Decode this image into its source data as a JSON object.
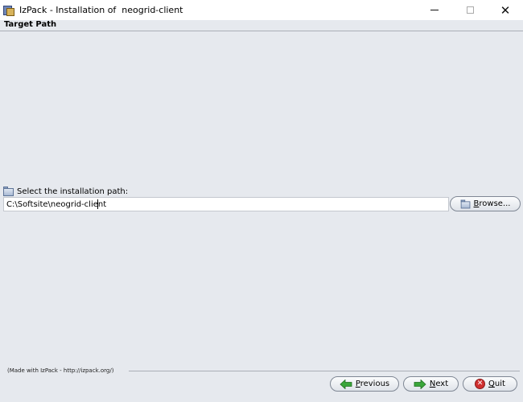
{
  "window": {
    "title": "IzPack - Installation of  neogrid-client",
    "icon": "izpack-app-icon",
    "controls": {
      "minimize": "minimize-icon",
      "maximize": "maximize-icon",
      "close": "✕"
    }
  },
  "panel": {
    "header": "Target Path",
    "path_label": "Select the installation path:",
    "path_value": "C:\\Softsite\\neogrid-client",
    "browse": {
      "mnemonic": "B",
      "rest": "rowse..."
    }
  },
  "footer": {
    "made_with": "(Made with IzPack - http://izpack.org/)",
    "previous": {
      "mnemonic": "P",
      "rest": "revious"
    },
    "next": {
      "mnemonic": "N",
      "rest": "ext"
    },
    "quit": {
      "mnemonic": "Q",
      "rest": "uit"
    }
  },
  "colors": {
    "background": "#e6e9ee",
    "arrow_green": "#3aa63a",
    "quit_red": "#d03030"
  }
}
